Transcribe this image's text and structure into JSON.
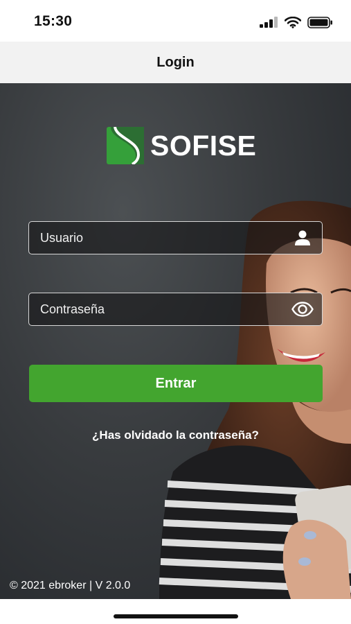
{
  "status_bar": {
    "time": "15:30",
    "icons": [
      "cellular-signal-icon",
      "wifi-icon",
      "battery-icon"
    ]
  },
  "nav": {
    "title": "Login"
  },
  "brand": {
    "name": "SOFISE",
    "accent_color": "#43a52f"
  },
  "form": {
    "username": {
      "placeholder": "Usuario",
      "value": "",
      "icon": "user-icon"
    },
    "password": {
      "placeholder": "Contraseña",
      "value": "",
      "icon": "eye-icon"
    },
    "submit_label": "Entrar",
    "forgot_label": "¿Has olvidado la contraseña?"
  },
  "footer": {
    "version_text": "© 2021 ebroker | V 2.0.0"
  }
}
